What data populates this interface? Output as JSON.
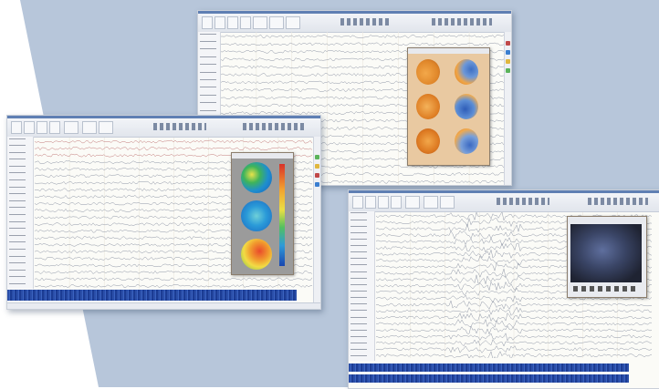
{
  "colors": {
    "background": "#b7c6da",
    "window_face": "#fbfbf7",
    "trace": "#8f96a6",
    "trace_highlight": "#c27a7a",
    "spectrum_strip": "#2a4ea8"
  },
  "windows": [
    {
      "name": "top-window",
      "toolbar_buttons": [
        "",
        "",
        "",
        "",
        "",
        "",
        "",
        "",
        ""
      ],
      "channels": [
        "",
        "",
        "",
        "",
        "",
        "",
        "",
        "",
        "",
        "",
        "",
        "",
        "",
        "",
        "",
        "",
        "",
        "",
        "",
        ""
      ],
      "popup": {
        "kind": "topographic-maps",
        "heads": [
          "head-map-1",
          "head-map-2",
          "head-map-3",
          "head-map-4",
          "head-map-5",
          "head-map-6"
        ]
      }
    },
    {
      "name": "left-window",
      "toolbar_buttons": [
        "",
        "",
        "",
        "",
        "",
        "",
        "",
        "",
        ""
      ],
      "channels": [
        "",
        "",
        "",
        "",
        "",
        "",
        "",
        "",
        "",
        "",
        "",
        "",
        "",
        "",
        "",
        "",
        "",
        "",
        "",
        "",
        "",
        ""
      ],
      "popup": {
        "kind": "topographic-maps",
        "heads": [
          "head-map-1",
          "head-map-2",
          "head-map-3"
        ]
      }
    },
    {
      "name": "right-window",
      "toolbar_buttons": [
        "",
        "",
        "",
        "",
        "",
        "",
        "",
        ""
      ],
      "channels": [
        "",
        "",
        "",
        "",
        "",
        "",
        "",
        "",
        "",
        "",
        "",
        "",
        "",
        "",
        "",
        "",
        "",
        "",
        "",
        "",
        "",
        "",
        ""
      ],
      "popup": {
        "kind": "video"
      }
    }
  ]
}
